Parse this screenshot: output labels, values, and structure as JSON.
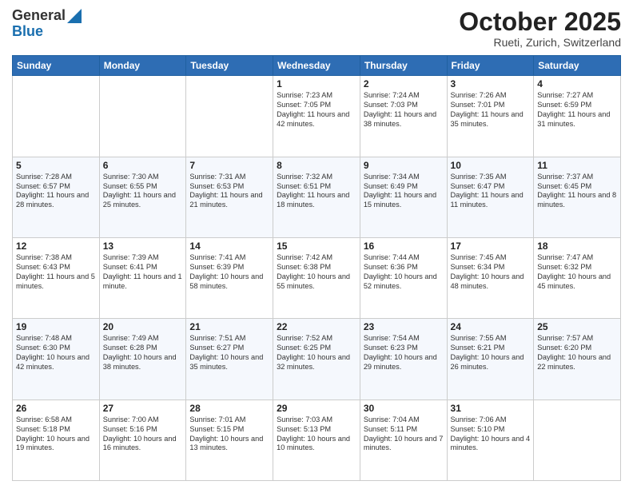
{
  "header": {
    "logo_line1": "General",
    "logo_line2": "Blue",
    "month": "October 2025",
    "location": "Rueti, Zurich, Switzerland"
  },
  "days_of_week": [
    "Sunday",
    "Monday",
    "Tuesday",
    "Wednesday",
    "Thursday",
    "Friday",
    "Saturday"
  ],
  "weeks": [
    [
      {
        "day": "",
        "sunrise": "",
        "sunset": "",
        "daylight": ""
      },
      {
        "day": "",
        "sunrise": "",
        "sunset": "",
        "daylight": ""
      },
      {
        "day": "",
        "sunrise": "",
        "sunset": "",
        "daylight": ""
      },
      {
        "day": "1",
        "sunrise": "Sunrise: 7:23 AM",
        "sunset": "Sunset: 7:05 PM",
        "daylight": "Daylight: 11 hours and 42 minutes."
      },
      {
        "day": "2",
        "sunrise": "Sunrise: 7:24 AM",
        "sunset": "Sunset: 7:03 PM",
        "daylight": "Daylight: 11 hours and 38 minutes."
      },
      {
        "day": "3",
        "sunrise": "Sunrise: 7:26 AM",
        "sunset": "Sunset: 7:01 PM",
        "daylight": "Daylight: 11 hours and 35 minutes."
      },
      {
        "day": "4",
        "sunrise": "Sunrise: 7:27 AM",
        "sunset": "Sunset: 6:59 PM",
        "daylight": "Daylight: 11 hours and 31 minutes."
      }
    ],
    [
      {
        "day": "5",
        "sunrise": "Sunrise: 7:28 AM",
        "sunset": "Sunset: 6:57 PM",
        "daylight": "Daylight: 11 hours and 28 minutes."
      },
      {
        "day": "6",
        "sunrise": "Sunrise: 7:30 AM",
        "sunset": "Sunset: 6:55 PM",
        "daylight": "Daylight: 11 hours and 25 minutes."
      },
      {
        "day": "7",
        "sunrise": "Sunrise: 7:31 AM",
        "sunset": "Sunset: 6:53 PM",
        "daylight": "Daylight: 11 hours and 21 minutes."
      },
      {
        "day": "8",
        "sunrise": "Sunrise: 7:32 AM",
        "sunset": "Sunset: 6:51 PM",
        "daylight": "Daylight: 11 hours and 18 minutes."
      },
      {
        "day": "9",
        "sunrise": "Sunrise: 7:34 AM",
        "sunset": "Sunset: 6:49 PM",
        "daylight": "Daylight: 11 hours and 15 minutes."
      },
      {
        "day": "10",
        "sunrise": "Sunrise: 7:35 AM",
        "sunset": "Sunset: 6:47 PM",
        "daylight": "Daylight: 11 hours and 11 minutes."
      },
      {
        "day": "11",
        "sunrise": "Sunrise: 7:37 AM",
        "sunset": "Sunset: 6:45 PM",
        "daylight": "Daylight: 11 hours and 8 minutes."
      }
    ],
    [
      {
        "day": "12",
        "sunrise": "Sunrise: 7:38 AM",
        "sunset": "Sunset: 6:43 PM",
        "daylight": "Daylight: 11 hours and 5 minutes."
      },
      {
        "day": "13",
        "sunrise": "Sunrise: 7:39 AM",
        "sunset": "Sunset: 6:41 PM",
        "daylight": "Daylight: 11 hours and 1 minute."
      },
      {
        "day": "14",
        "sunrise": "Sunrise: 7:41 AM",
        "sunset": "Sunset: 6:39 PM",
        "daylight": "Daylight: 10 hours and 58 minutes."
      },
      {
        "day": "15",
        "sunrise": "Sunrise: 7:42 AM",
        "sunset": "Sunset: 6:38 PM",
        "daylight": "Daylight: 10 hours and 55 minutes."
      },
      {
        "day": "16",
        "sunrise": "Sunrise: 7:44 AM",
        "sunset": "Sunset: 6:36 PM",
        "daylight": "Daylight: 10 hours and 52 minutes."
      },
      {
        "day": "17",
        "sunrise": "Sunrise: 7:45 AM",
        "sunset": "Sunset: 6:34 PM",
        "daylight": "Daylight: 10 hours and 48 minutes."
      },
      {
        "day": "18",
        "sunrise": "Sunrise: 7:47 AM",
        "sunset": "Sunset: 6:32 PM",
        "daylight": "Daylight: 10 hours and 45 minutes."
      }
    ],
    [
      {
        "day": "19",
        "sunrise": "Sunrise: 7:48 AM",
        "sunset": "Sunset: 6:30 PM",
        "daylight": "Daylight: 10 hours and 42 minutes."
      },
      {
        "day": "20",
        "sunrise": "Sunrise: 7:49 AM",
        "sunset": "Sunset: 6:28 PM",
        "daylight": "Daylight: 10 hours and 38 minutes."
      },
      {
        "day": "21",
        "sunrise": "Sunrise: 7:51 AM",
        "sunset": "Sunset: 6:27 PM",
        "daylight": "Daylight: 10 hours and 35 minutes."
      },
      {
        "day": "22",
        "sunrise": "Sunrise: 7:52 AM",
        "sunset": "Sunset: 6:25 PM",
        "daylight": "Daylight: 10 hours and 32 minutes."
      },
      {
        "day": "23",
        "sunrise": "Sunrise: 7:54 AM",
        "sunset": "Sunset: 6:23 PM",
        "daylight": "Daylight: 10 hours and 29 minutes."
      },
      {
        "day": "24",
        "sunrise": "Sunrise: 7:55 AM",
        "sunset": "Sunset: 6:21 PM",
        "daylight": "Daylight: 10 hours and 26 minutes."
      },
      {
        "day": "25",
        "sunrise": "Sunrise: 7:57 AM",
        "sunset": "Sunset: 6:20 PM",
        "daylight": "Daylight: 10 hours and 22 minutes."
      }
    ],
    [
      {
        "day": "26",
        "sunrise": "Sunrise: 6:58 AM",
        "sunset": "Sunset: 5:18 PM",
        "daylight": "Daylight: 10 hours and 19 minutes."
      },
      {
        "day": "27",
        "sunrise": "Sunrise: 7:00 AM",
        "sunset": "Sunset: 5:16 PM",
        "daylight": "Daylight: 10 hours and 16 minutes."
      },
      {
        "day": "28",
        "sunrise": "Sunrise: 7:01 AM",
        "sunset": "Sunset: 5:15 PM",
        "daylight": "Daylight: 10 hours and 13 minutes."
      },
      {
        "day": "29",
        "sunrise": "Sunrise: 7:03 AM",
        "sunset": "Sunset: 5:13 PM",
        "daylight": "Daylight: 10 hours and 10 minutes."
      },
      {
        "day": "30",
        "sunrise": "Sunrise: 7:04 AM",
        "sunset": "Sunset: 5:11 PM",
        "daylight": "Daylight: 10 hours and 7 minutes."
      },
      {
        "day": "31",
        "sunrise": "Sunrise: 7:06 AM",
        "sunset": "Sunset: 5:10 PM",
        "daylight": "Daylight: 10 hours and 4 minutes."
      },
      {
        "day": "",
        "sunrise": "",
        "sunset": "",
        "daylight": ""
      }
    ]
  ]
}
